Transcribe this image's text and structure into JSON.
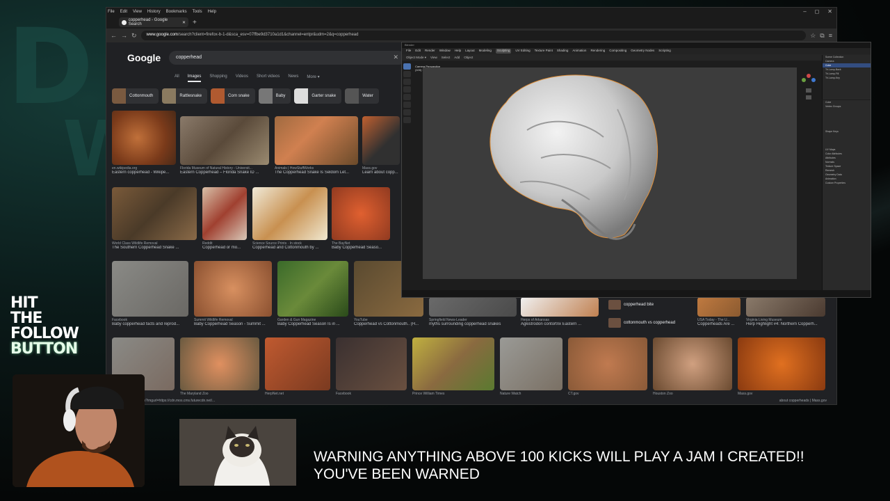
{
  "browser": {
    "menu": [
      "File",
      "Edit",
      "View",
      "History",
      "Bookmarks",
      "Tools",
      "Help"
    ],
    "tab_title": "copperhead - Google Search",
    "url_host": "www.google.com",
    "url_rest": "/search?client=firefox-b-1-d&sca_esv=07ffbe9d3710a1d1&channel=entpr&udm=2&q=copperhead"
  },
  "google": {
    "logo": "Google",
    "query": "copperhead",
    "tabs": [
      "All",
      "Images",
      "Shopping",
      "Videos",
      "Short videos",
      "News",
      "More ▾"
    ],
    "chips": [
      "Cottonmouth",
      "Rattlesnake",
      "Corn snake",
      "Baby",
      "Garter snake",
      "Water"
    ],
    "results": [
      {
        "src": "en.wikipedia.org",
        "cap": "Eastern copperhead - Wikipe..."
      },
      {
        "src": "Florida Museum of Natural History - Universit...",
        "cap": "Eastern Copperhead – Florida Snake ID ..."
      },
      {
        "src": "Animals | HowStuffWorks",
        "cap": "The Copperhead Snake Is Seldom Let..."
      },
      {
        "src": "Mass.gov",
        "cap": "Learn about copp..."
      },
      {
        "src": "World Class Wildlife Removal",
        "cap": "The Southern Copperhead Snake ..."
      },
      {
        "src": "Reddit",
        "cap": "Copperhead or mo..."
      },
      {
        "src": "Science Source Prints · In stock",
        "cap": "Copperhead and Cottonmouth by ..."
      },
      {
        "src": "The BayNet",
        "cap": "Baby Copperhead Seaso..."
      },
      {
        "src": "Facebook",
        "cap": "Baby copperhead facts and reprod..."
      },
      {
        "src": "Summit Wildlife Removal",
        "cap": "Baby Copperhead Season - Summit ..."
      },
      {
        "src": "Garden & Gun Magazine",
        "cap": "Baby Copperhead Season Is in ..."
      },
      {
        "src": "YouTube",
        "cap": "Copperhead vs Cottonmouth.. (H..."
      },
      {
        "src": "Springfield News-Leader",
        "cap": "myths surrounding copperhead snakes"
      },
      {
        "src": "Herps of Arkansas",
        "cap": "Agkistrodon contortrix Eastern ..."
      },
      {
        "src": "USA Today - The U...",
        "cap": "Copperheads Are ..."
      },
      {
        "src": "Virginia Living Museum",
        "cap": "Herp Highlight #4: Northern Copperh..."
      }
    ],
    "related": [
      "copperhead bite",
      "cottonmouth vs copperhead"
    ],
    "bottom_sources": [
      "Discovery Center",
      "The Maryland Zoo",
      "HerpNet.net",
      "Facebook",
      "Prince William Times",
      "Nature Watch",
      "CT.gov",
      "Houston Zoo",
      "Mass.gov"
    ],
    "status_url": "google.com/imgres?imgurl=https://cdn.mos.cms.futurecdn.net/...",
    "status_tail": "about copperheads | Mass.gov"
  },
  "blender": {
    "menu": [
      "File",
      "Edit",
      "Render",
      "Window",
      "Help"
    ],
    "workspaces": [
      "Layout",
      "Modeling",
      "Sculpting",
      "UV Editing",
      "Texture Paint",
      "Shading",
      "Animation",
      "Rendering",
      "Compositing",
      "Geometry Nodes",
      "Scripting"
    ],
    "active_workspace": "Sculpting",
    "viewport_label_1": "Camera Perspective",
    "viewport_label_2": "(100) Scene Collection | Cube",
    "outliner": [
      "Scene Collection",
      "Camera",
      "Cube",
      "Tri.Lamp-Back",
      "Tri.Lamp-Fill",
      "Tri.Lamp-Key"
    ],
    "props": [
      "Vertex Groups",
      "Shape Keys",
      "UV Maps",
      "Color Attributes",
      "Attributes",
      "Normals",
      "Texture Space",
      "Remesh",
      "Geometry Data",
      "Animation",
      "Custom Properties"
    ],
    "object": "Cube"
  },
  "overlay": {
    "follow": [
      "HIT",
      "THE",
      "FOLLOW",
      "BUTTON"
    ],
    "warning_line1": "WARNING ANYTHING ABOVE 100 KICKS WILL PLAY A JAM I CREATED!!",
    "warning_line2": "YOU'VE BEEN WARNED"
  }
}
